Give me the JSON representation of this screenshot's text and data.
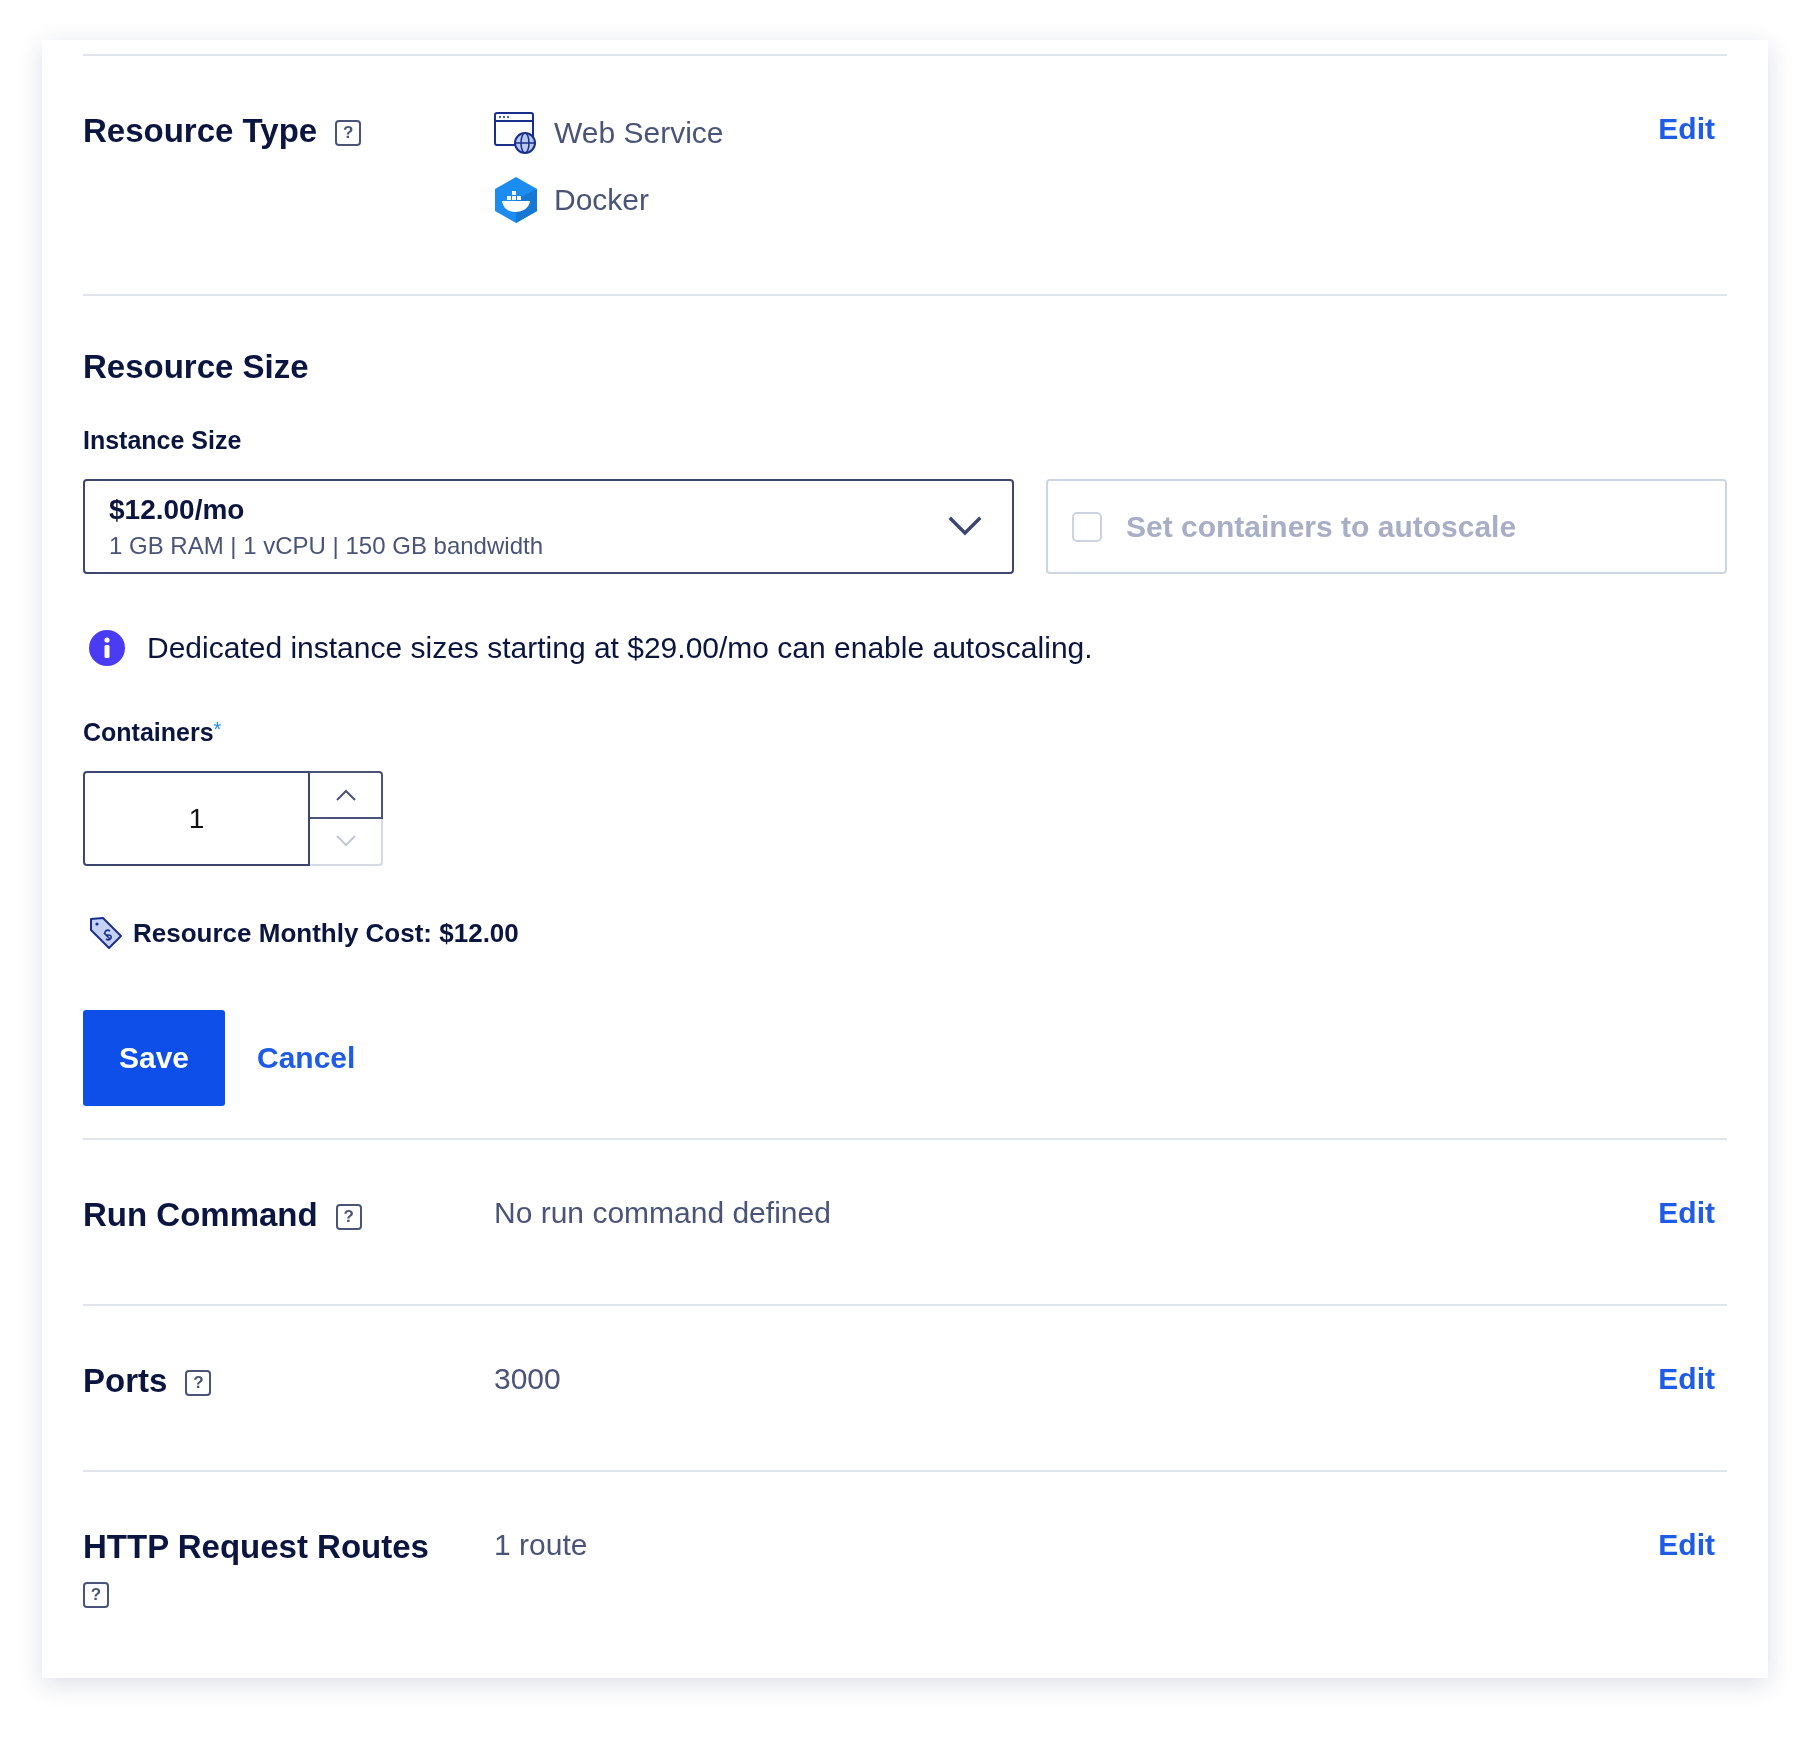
{
  "sections_top": [
    {
      "title": "Resource Type",
      "help": "?",
      "values": [
        {
          "kind": "web",
          "text": "Web Service"
        },
        {
          "kind": "docker",
          "text": "Docker"
        }
      ],
      "action": "Edit"
    }
  ],
  "resource_size": {
    "title": "Resource Size",
    "instance_label": "Instance Size",
    "instance": {
      "price": "$12.00/mo",
      "specs": "1 GB RAM | 1 vCPU | 150 GB bandwidth"
    },
    "autoscale": {
      "label": "Set containers to autoscale",
      "checked": false,
      "disabled": true
    },
    "info": "Dedicated instance sizes starting at $29.00/mo can enable autoscaling.",
    "containers": {
      "label": "Containers",
      "required": "*",
      "value": "1",
      "down_disabled": true
    },
    "cost": "Resource Monthly Cost: $12.00",
    "buttons": {
      "save": "Save",
      "cancel": "Cancel"
    }
  },
  "sections_bottom": [
    {
      "title": "Run Command",
      "help": "?",
      "value": "No run command defined",
      "action": "Edit"
    },
    {
      "title": "Ports",
      "help": "?",
      "value": "3000",
      "action": "Edit"
    },
    {
      "title": "HTTP Request Routes",
      "help": "?",
      "value": "1 route",
      "action": "Edit"
    }
  ]
}
